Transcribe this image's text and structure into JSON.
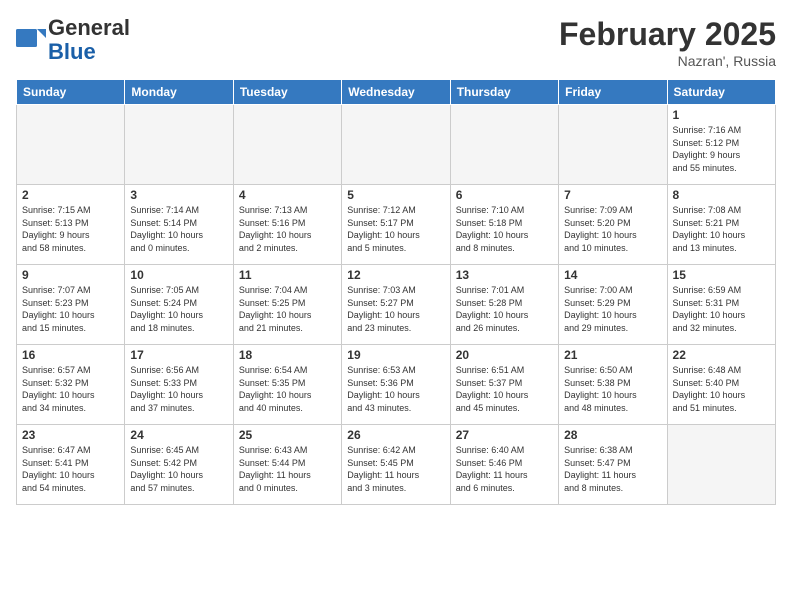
{
  "header": {
    "logo_line1": "General",
    "logo_line2": "Blue",
    "month_title": "February 2025",
    "location": "Nazran', Russia"
  },
  "weekdays": [
    "Sunday",
    "Monday",
    "Tuesday",
    "Wednesday",
    "Thursday",
    "Friday",
    "Saturday"
  ],
  "weeks": [
    [
      {
        "day": "",
        "info": ""
      },
      {
        "day": "",
        "info": ""
      },
      {
        "day": "",
        "info": ""
      },
      {
        "day": "",
        "info": ""
      },
      {
        "day": "",
        "info": ""
      },
      {
        "day": "",
        "info": ""
      },
      {
        "day": "1",
        "info": "Sunrise: 7:16 AM\nSunset: 5:12 PM\nDaylight: 9 hours\nand 55 minutes."
      }
    ],
    [
      {
        "day": "2",
        "info": "Sunrise: 7:15 AM\nSunset: 5:13 PM\nDaylight: 9 hours\nand 58 minutes."
      },
      {
        "day": "3",
        "info": "Sunrise: 7:14 AM\nSunset: 5:14 PM\nDaylight: 10 hours\nand 0 minutes."
      },
      {
        "day": "4",
        "info": "Sunrise: 7:13 AM\nSunset: 5:16 PM\nDaylight: 10 hours\nand 2 minutes."
      },
      {
        "day": "5",
        "info": "Sunrise: 7:12 AM\nSunset: 5:17 PM\nDaylight: 10 hours\nand 5 minutes."
      },
      {
        "day": "6",
        "info": "Sunrise: 7:10 AM\nSunset: 5:18 PM\nDaylight: 10 hours\nand 8 minutes."
      },
      {
        "day": "7",
        "info": "Sunrise: 7:09 AM\nSunset: 5:20 PM\nDaylight: 10 hours\nand 10 minutes."
      },
      {
        "day": "8",
        "info": "Sunrise: 7:08 AM\nSunset: 5:21 PM\nDaylight: 10 hours\nand 13 minutes."
      }
    ],
    [
      {
        "day": "9",
        "info": "Sunrise: 7:07 AM\nSunset: 5:23 PM\nDaylight: 10 hours\nand 15 minutes."
      },
      {
        "day": "10",
        "info": "Sunrise: 7:05 AM\nSunset: 5:24 PM\nDaylight: 10 hours\nand 18 minutes."
      },
      {
        "day": "11",
        "info": "Sunrise: 7:04 AM\nSunset: 5:25 PM\nDaylight: 10 hours\nand 21 minutes."
      },
      {
        "day": "12",
        "info": "Sunrise: 7:03 AM\nSunset: 5:27 PM\nDaylight: 10 hours\nand 23 minutes."
      },
      {
        "day": "13",
        "info": "Sunrise: 7:01 AM\nSunset: 5:28 PM\nDaylight: 10 hours\nand 26 minutes."
      },
      {
        "day": "14",
        "info": "Sunrise: 7:00 AM\nSunset: 5:29 PM\nDaylight: 10 hours\nand 29 minutes."
      },
      {
        "day": "15",
        "info": "Sunrise: 6:59 AM\nSunset: 5:31 PM\nDaylight: 10 hours\nand 32 minutes."
      }
    ],
    [
      {
        "day": "16",
        "info": "Sunrise: 6:57 AM\nSunset: 5:32 PM\nDaylight: 10 hours\nand 34 minutes."
      },
      {
        "day": "17",
        "info": "Sunrise: 6:56 AM\nSunset: 5:33 PM\nDaylight: 10 hours\nand 37 minutes."
      },
      {
        "day": "18",
        "info": "Sunrise: 6:54 AM\nSunset: 5:35 PM\nDaylight: 10 hours\nand 40 minutes."
      },
      {
        "day": "19",
        "info": "Sunrise: 6:53 AM\nSunset: 5:36 PM\nDaylight: 10 hours\nand 43 minutes."
      },
      {
        "day": "20",
        "info": "Sunrise: 6:51 AM\nSunset: 5:37 PM\nDaylight: 10 hours\nand 45 minutes."
      },
      {
        "day": "21",
        "info": "Sunrise: 6:50 AM\nSunset: 5:38 PM\nDaylight: 10 hours\nand 48 minutes."
      },
      {
        "day": "22",
        "info": "Sunrise: 6:48 AM\nSunset: 5:40 PM\nDaylight: 10 hours\nand 51 minutes."
      }
    ],
    [
      {
        "day": "23",
        "info": "Sunrise: 6:47 AM\nSunset: 5:41 PM\nDaylight: 10 hours\nand 54 minutes."
      },
      {
        "day": "24",
        "info": "Sunrise: 6:45 AM\nSunset: 5:42 PM\nDaylight: 10 hours\nand 57 minutes."
      },
      {
        "day": "25",
        "info": "Sunrise: 6:43 AM\nSunset: 5:44 PM\nDaylight: 11 hours\nand 0 minutes."
      },
      {
        "day": "26",
        "info": "Sunrise: 6:42 AM\nSunset: 5:45 PM\nDaylight: 11 hours\nand 3 minutes."
      },
      {
        "day": "27",
        "info": "Sunrise: 6:40 AM\nSunset: 5:46 PM\nDaylight: 11 hours\nand 6 minutes."
      },
      {
        "day": "28",
        "info": "Sunrise: 6:38 AM\nSunset: 5:47 PM\nDaylight: 11 hours\nand 8 minutes."
      },
      {
        "day": "",
        "info": ""
      }
    ]
  ]
}
